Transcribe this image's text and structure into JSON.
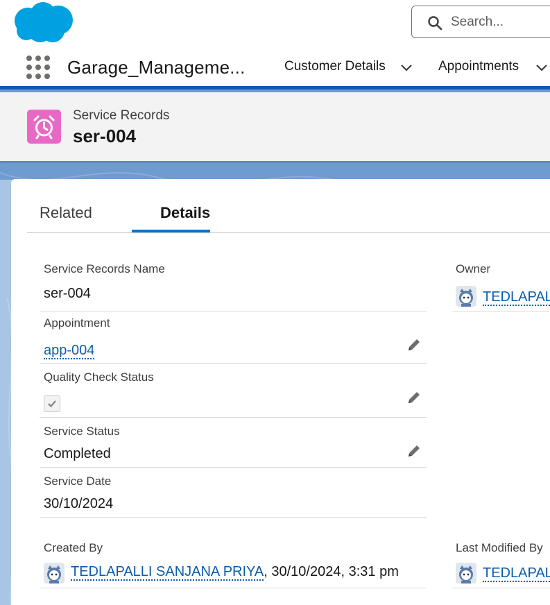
{
  "header": {
    "search_placeholder": "Search..."
  },
  "nav": {
    "app_name": "Garage_Manageme...",
    "items": [
      {
        "label": "Customer Details"
      },
      {
        "label": "Appointments"
      }
    ]
  },
  "record": {
    "object_label": "Service Records",
    "title": "ser-004"
  },
  "tabs": {
    "related": "Related",
    "details": "Details",
    "active": "Details"
  },
  "fields": {
    "service_records_name": {
      "label": "Service Records Name",
      "value": "ser-004"
    },
    "owner": {
      "label": "Owner",
      "value": "TEDLAPALLI"
    },
    "appointment": {
      "label": "Appointment",
      "value": "app-004"
    },
    "quality_check_status": {
      "label": "Quality Check Status",
      "checked": true
    },
    "service_status": {
      "label": "Service Status",
      "value": "Completed"
    },
    "service_date": {
      "label": "Service Date",
      "value": "30/10/2024"
    },
    "created_by": {
      "label": "Created By",
      "user": "TEDLAPALLI SANJANA PRIYA",
      "datetime": ", 30/10/2024, 3:31 pm"
    },
    "last_modified_by": {
      "label": "Last Modified By",
      "user": "TEDLAPALLI"
    }
  },
  "colors": {
    "brand_blue": "#0176d3",
    "link_blue": "#0b5cab",
    "object_icon_pink": "#e869c5",
    "logo_blue": "#00a1e0"
  },
  "icons": [
    "salesforce-logo",
    "search-icon",
    "app-launcher-icon",
    "chevron-down-icon",
    "alarm-clock-icon",
    "pencil-icon",
    "checkmark-icon",
    "user-avatar-icon"
  ]
}
